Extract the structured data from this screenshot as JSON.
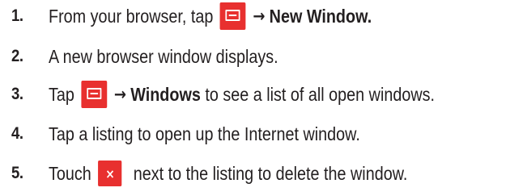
{
  "steps": [
    {
      "number": "1.",
      "before": "From your browser, tap",
      "icon": "menu-icon",
      "arrow": "→",
      "bold": "New Window.",
      "after": ""
    },
    {
      "number": "2.",
      "text": "A new browser window displays."
    },
    {
      "number": "3.",
      "before": "Tap",
      "icon": "menu-icon",
      "arrow": "→",
      "bold": "Windows",
      "after": " to see a list of all open windows."
    },
    {
      "number": "4.",
      "text": "Tap a listing to open up the Internet window."
    },
    {
      "number": "5.",
      "before": "Touch",
      "icon": "close-icon",
      "icon_glyph": "×",
      "after": " next to the listing to delete the window."
    }
  ],
  "colors": {
    "icon_background": "#e8302f",
    "text": "#231f20"
  }
}
